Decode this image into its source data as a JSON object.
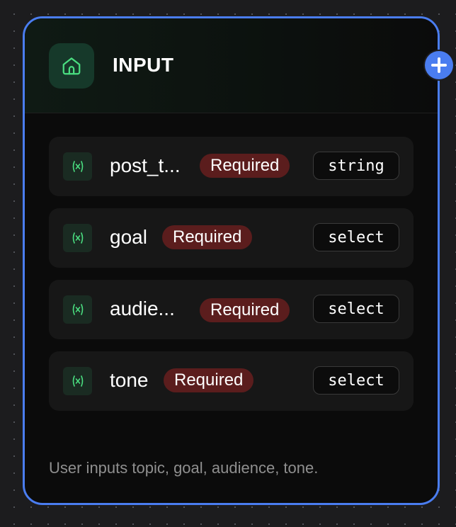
{
  "node": {
    "title": "INPUT",
    "header_icon": "home-icon",
    "description": "User inputs topic, goal, audience, tone.",
    "border_color": "#4a7df0",
    "variables": [
      {
        "name": "post_t...",
        "badge": "Required",
        "type": "string",
        "icon": "variable-icon"
      },
      {
        "name": "goal",
        "badge": "Required",
        "type": "select",
        "icon": "variable-icon"
      },
      {
        "name": "audie...",
        "badge": "Required",
        "type": "select",
        "icon": "variable-icon"
      },
      {
        "name": "tone",
        "badge": "Required",
        "type": "select",
        "icon": "variable-icon"
      }
    ]
  },
  "add_handle": {
    "icon": "plus-icon",
    "color": "#4a7df0"
  },
  "colors": {
    "accent_green": "#4ade80",
    "badge_bg": "#5b1d1d",
    "canvas_bg": "#1c1c1e"
  }
}
